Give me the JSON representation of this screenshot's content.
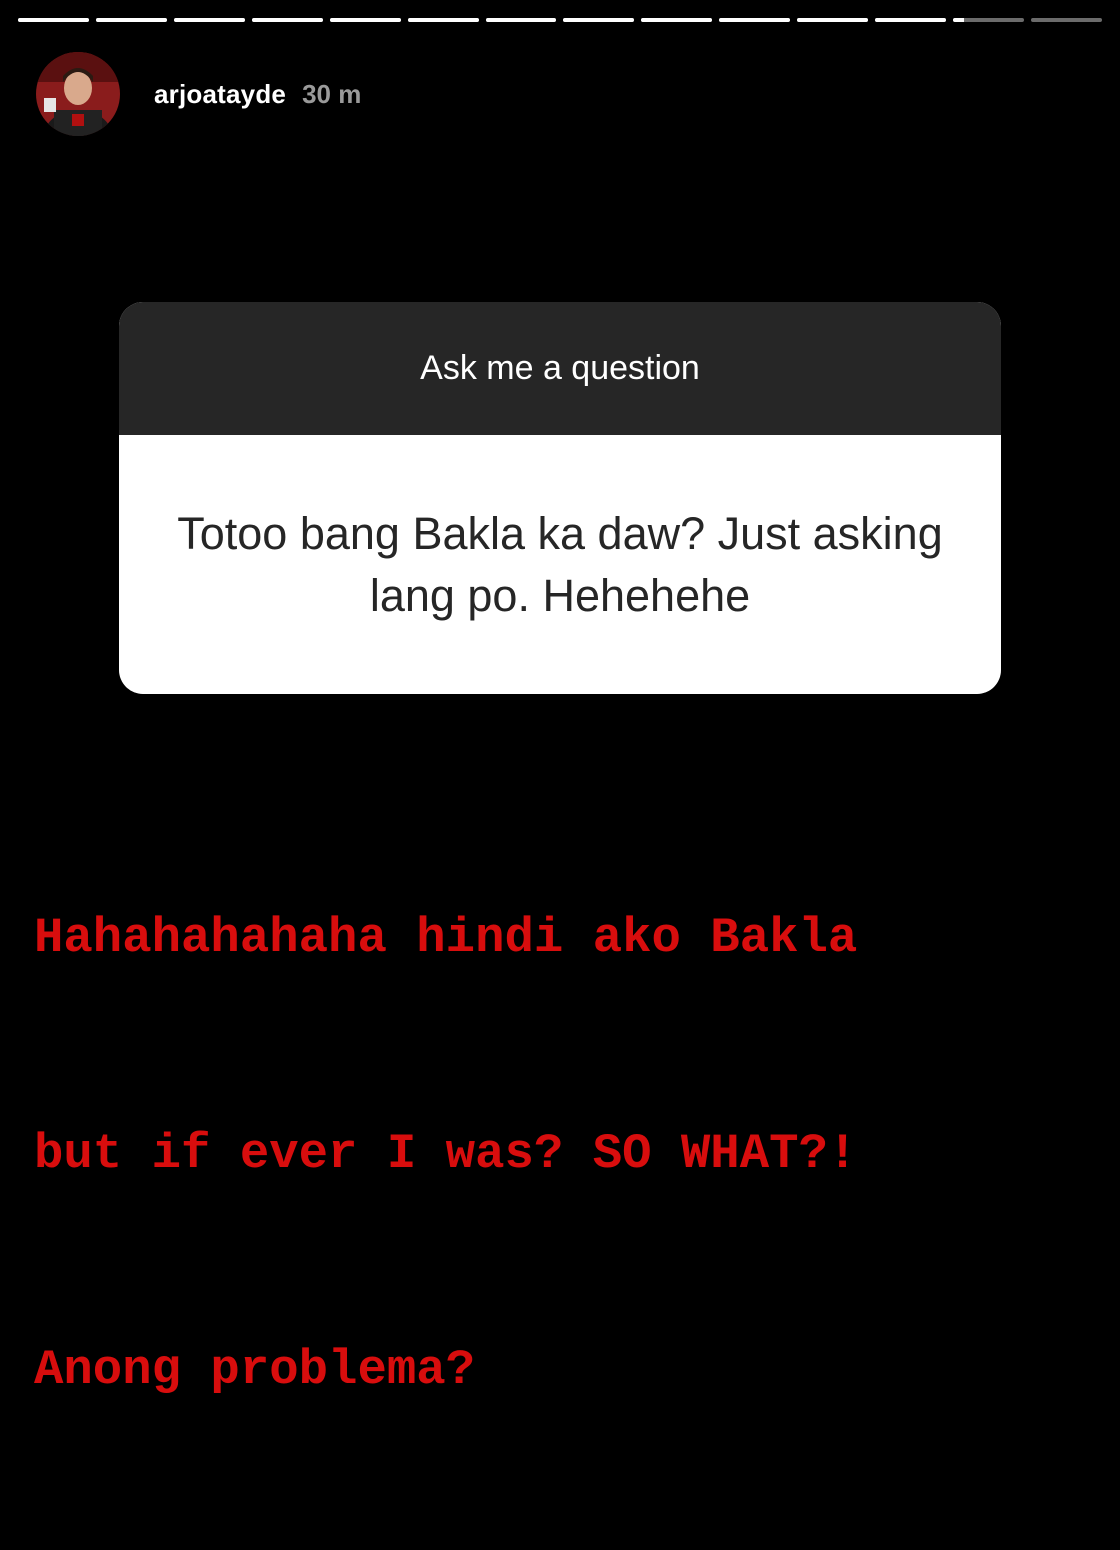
{
  "story": {
    "progress": {
      "segment_count": 14,
      "active_segment_index": 12,
      "active_segment_fraction": 0.15
    },
    "header": {
      "username": "arjoatayde",
      "time_ago": "30 m",
      "avatar_icon": "profile-avatar"
    },
    "question_sticker": {
      "title": "Ask me a question",
      "question": "Totoo bang Bakla ka daw? Just asking lang po. Hehehehe"
    },
    "reply": {
      "lines": [
        "Hahahahahaha hindi ako Bakla",
        "but if ever I was? SO WHAT?!",
        "Anong problema?"
      ],
      "color": "#d80d0d"
    },
    "colors": {
      "background": "#000000",
      "sticker_header": "#262626",
      "sticker_body": "#ffffff",
      "progress_done": "#ffffff",
      "progress_pending": "#6b6b6b"
    }
  }
}
